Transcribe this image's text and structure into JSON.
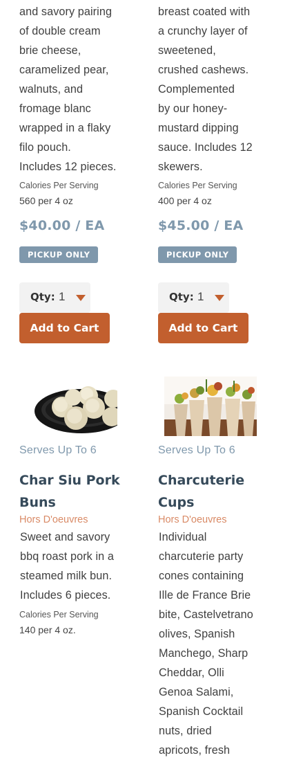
{
  "products_top": [
    {
      "description": "and savory pairing\nof double cream\nbrie cheese,\ncaramelized pear,\nwalnuts, and\nfromage blanc\nwrapped in a flaky\nfilo pouch.\nIncludes 12 pieces.",
      "calories_label": "Calories Per Serving",
      "calories_value": "560 per 4 oz",
      "price": "$40.00 / EA",
      "badge": "PICKUP ONLY",
      "qty_label": "Qty:",
      "qty_value": "1",
      "cart_label": "Add to Cart"
    },
    {
      "description": "breast coated with\na crunchy layer of\nsweetened,\ncrushed cashews.\nComplemented\nby our honey-\nmustard dipping\nsauce. Includes 12\nskewers.",
      "calories_label": "Calories Per Serving",
      "calories_value": "400 per 4 oz",
      "price": "$45.00 / EA",
      "badge": "PICKUP ONLY",
      "qty_label": "Qty:",
      "qty_value": "1",
      "cart_label": "Add to Cart"
    }
  ],
  "products_bottom": [
    {
      "serves": "Serves Up To 6",
      "name_line1": "Char Siu Pork",
      "name_line2": "Buns",
      "category": "Hors D'oeuvres",
      "description": "Sweet and savory\nbbq roast pork in a\nsteamed milk bun.\nIncludes 6 pieces.",
      "calories_label": "Calories Per Serving",
      "calories_value": "140 per 4 oz."
    },
    {
      "serves": "Serves Up To 6",
      "name_line1": "Charcuterie",
      "name_line2": "Cups",
      "category": "Hors D'oeuvres",
      "description": "Individual\ncharcuterie party\ncones containing\nIlle de France Brie\nbite, Castelvetrano\nolives, Spanish\nManchego, Sharp\nCheddar, Olli\nGenoa Salami,\nSpanish Cocktail\nnuts, dried\napricots, fresh"
    }
  ],
  "colors": {
    "accent": "#c25f2e",
    "slate": "#7f98ac",
    "title": "#364a5a",
    "category": "#d98a66"
  }
}
